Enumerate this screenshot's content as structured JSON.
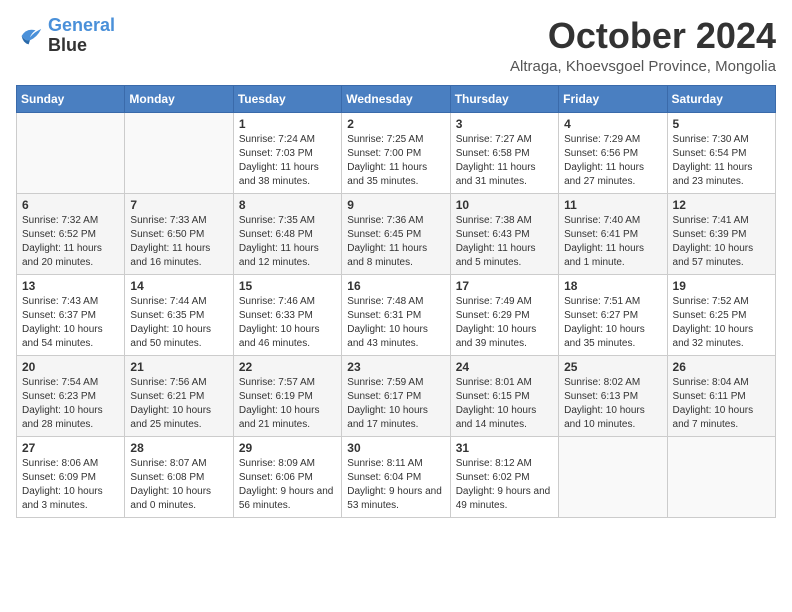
{
  "header": {
    "logo_line1": "General",
    "logo_line2": "Blue",
    "month": "October 2024",
    "location": "Altraga, Khoevsgoel Province, Mongolia"
  },
  "weekdays": [
    "Sunday",
    "Monday",
    "Tuesday",
    "Wednesday",
    "Thursday",
    "Friday",
    "Saturday"
  ],
  "weeks": [
    [
      {
        "day": "",
        "info": ""
      },
      {
        "day": "",
        "info": ""
      },
      {
        "day": "1",
        "info": "Sunrise: 7:24 AM\nSunset: 7:03 PM\nDaylight: 11 hours and 38 minutes."
      },
      {
        "day": "2",
        "info": "Sunrise: 7:25 AM\nSunset: 7:00 PM\nDaylight: 11 hours and 35 minutes."
      },
      {
        "day": "3",
        "info": "Sunrise: 7:27 AM\nSunset: 6:58 PM\nDaylight: 11 hours and 31 minutes."
      },
      {
        "day": "4",
        "info": "Sunrise: 7:29 AM\nSunset: 6:56 PM\nDaylight: 11 hours and 27 minutes."
      },
      {
        "day": "5",
        "info": "Sunrise: 7:30 AM\nSunset: 6:54 PM\nDaylight: 11 hours and 23 minutes."
      }
    ],
    [
      {
        "day": "6",
        "info": "Sunrise: 7:32 AM\nSunset: 6:52 PM\nDaylight: 11 hours and 20 minutes."
      },
      {
        "day": "7",
        "info": "Sunrise: 7:33 AM\nSunset: 6:50 PM\nDaylight: 11 hours and 16 minutes."
      },
      {
        "day": "8",
        "info": "Sunrise: 7:35 AM\nSunset: 6:48 PM\nDaylight: 11 hours and 12 minutes."
      },
      {
        "day": "9",
        "info": "Sunrise: 7:36 AM\nSunset: 6:45 PM\nDaylight: 11 hours and 8 minutes."
      },
      {
        "day": "10",
        "info": "Sunrise: 7:38 AM\nSunset: 6:43 PM\nDaylight: 11 hours and 5 minutes."
      },
      {
        "day": "11",
        "info": "Sunrise: 7:40 AM\nSunset: 6:41 PM\nDaylight: 11 hours and 1 minute."
      },
      {
        "day": "12",
        "info": "Sunrise: 7:41 AM\nSunset: 6:39 PM\nDaylight: 10 hours and 57 minutes."
      }
    ],
    [
      {
        "day": "13",
        "info": "Sunrise: 7:43 AM\nSunset: 6:37 PM\nDaylight: 10 hours and 54 minutes."
      },
      {
        "day": "14",
        "info": "Sunrise: 7:44 AM\nSunset: 6:35 PM\nDaylight: 10 hours and 50 minutes."
      },
      {
        "day": "15",
        "info": "Sunrise: 7:46 AM\nSunset: 6:33 PM\nDaylight: 10 hours and 46 minutes."
      },
      {
        "day": "16",
        "info": "Sunrise: 7:48 AM\nSunset: 6:31 PM\nDaylight: 10 hours and 43 minutes."
      },
      {
        "day": "17",
        "info": "Sunrise: 7:49 AM\nSunset: 6:29 PM\nDaylight: 10 hours and 39 minutes."
      },
      {
        "day": "18",
        "info": "Sunrise: 7:51 AM\nSunset: 6:27 PM\nDaylight: 10 hours and 35 minutes."
      },
      {
        "day": "19",
        "info": "Sunrise: 7:52 AM\nSunset: 6:25 PM\nDaylight: 10 hours and 32 minutes."
      }
    ],
    [
      {
        "day": "20",
        "info": "Sunrise: 7:54 AM\nSunset: 6:23 PM\nDaylight: 10 hours and 28 minutes."
      },
      {
        "day": "21",
        "info": "Sunrise: 7:56 AM\nSunset: 6:21 PM\nDaylight: 10 hours and 25 minutes."
      },
      {
        "day": "22",
        "info": "Sunrise: 7:57 AM\nSunset: 6:19 PM\nDaylight: 10 hours and 21 minutes."
      },
      {
        "day": "23",
        "info": "Sunrise: 7:59 AM\nSunset: 6:17 PM\nDaylight: 10 hours and 17 minutes."
      },
      {
        "day": "24",
        "info": "Sunrise: 8:01 AM\nSunset: 6:15 PM\nDaylight: 10 hours and 14 minutes."
      },
      {
        "day": "25",
        "info": "Sunrise: 8:02 AM\nSunset: 6:13 PM\nDaylight: 10 hours and 10 minutes."
      },
      {
        "day": "26",
        "info": "Sunrise: 8:04 AM\nSunset: 6:11 PM\nDaylight: 10 hours and 7 minutes."
      }
    ],
    [
      {
        "day": "27",
        "info": "Sunrise: 8:06 AM\nSunset: 6:09 PM\nDaylight: 10 hours and 3 minutes."
      },
      {
        "day": "28",
        "info": "Sunrise: 8:07 AM\nSunset: 6:08 PM\nDaylight: 10 hours and 0 minutes."
      },
      {
        "day": "29",
        "info": "Sunrise: 8:09 AM\nSunset: 6:06 PM\nDaylight: 9 hours and 56 minutes."
      },
      {
        "day": "30",
        "info": "Sunrise: 8:11 AM\nSunset: 6:04 PM\nDaylight: 9 hours and 53 minutes."
      },
      {
        "day": "31",
        "info": "Sunrise: 8:12 AM\nSunset: 6:02 PM\nDaylight: 9 hours and 49 minutes."
      },
      {
        "day": "",
        "info": ""
      },
      {
        "day": "",
        "info": ""
      }
    ]
  ]
}
